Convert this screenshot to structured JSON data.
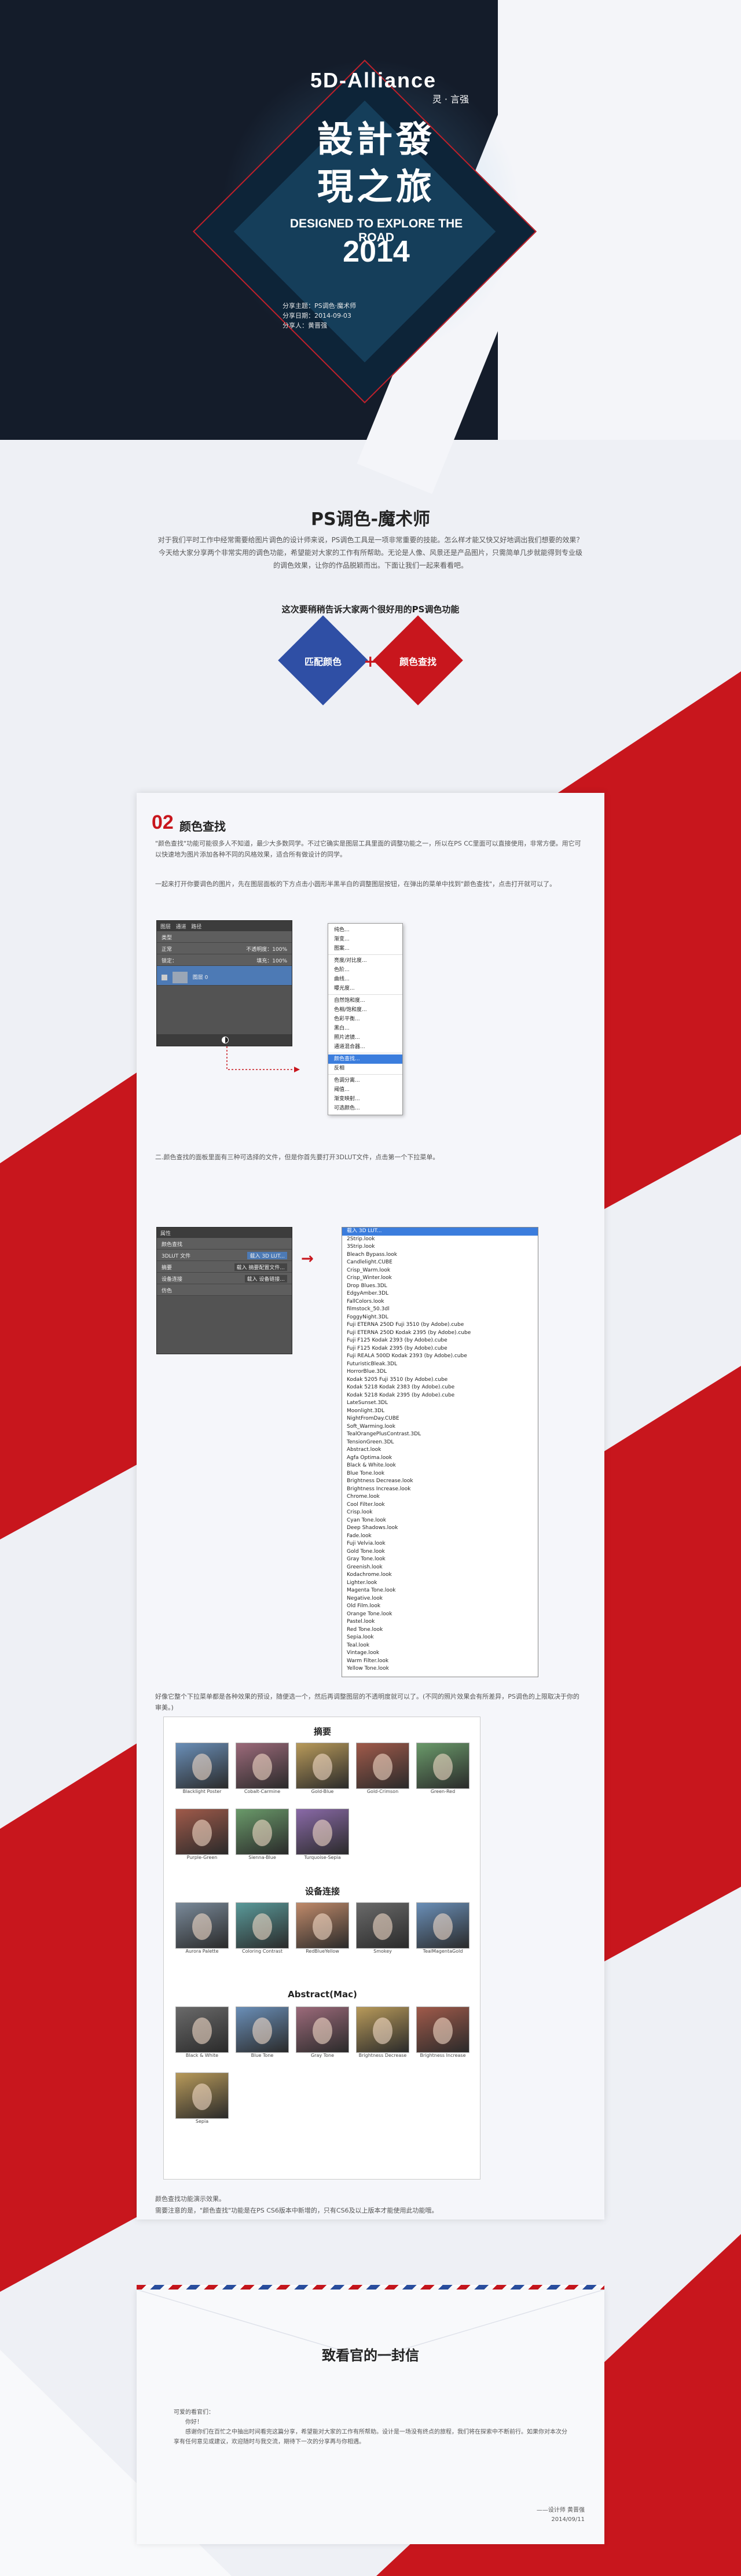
{
  "hero": {
    "brand": "5D-Alliance",
    "org": "灵 · 言强",
    "title_line1": "設計發",
    "title_line2": "現之旅",
    "subtitle_en": "DESIGNED TO EXPLORE THE ROAD",
    "year": "2014",
    "meta": [
      "分享主题：PS调色·魔术师",
      "分享日期：2014-09-03",
      "分享人：黄晋强"
    ]
  },
  "intro": {
    "title": "PS调色-魔术师",
    "text": "对于我们平时工作中经常需要给图片调色的设计师来说，PS调色工具是一项非常重要的技能。怎么样才能又快又好地调出我们想要的效果？今天给大家分享两个非常实用的调色功能，希望能对大家的工作有所帮助。无论是人像、风景还是产品图片，只需简单几步就能得到专业级的调色效果，让你的作品脱颖而出。下面让我们一起来看看吧。",
    "lead": "这次要稍稍告诉大家两个很好用的PS调色功能",
    "btn_match": "匹配颜色",
    "btn_plus": "+",
    "btn_lookup": "颜色查找"
  },
  "section": {
    "number": "02",
    "title": "颜色查找",
    "p1": "\"颜色查找\"功能可能很多人不知道，最少大多数同学。不过它确实是图层工具里面的调整功能之一，所以在PS CC里面可以直接使用，非常方便。用它可以快速地为图片添加各种不同的风格效果，适合所有做设计的同学。",
    "p2": "一起来打开你要调色的图片，先在图层面板的下方点击小圆形半黑半白的调整图层按钮，在弹出的菜单中找到\"颜色查找\"，点击打开就可以了。",
    "p3": "二.颜色查找的面板里面有三种可选择的文件，但是你首先要打开3DLUT文件，点击第一个下拉菜单。",
    "p4": "好像它整个下拉菜单都是各种效果的预设，随便选一个，然后再调整图层的不透明度就可以了。(不同的照片效果会有所差异，PS调色的上限取决于你的审美。)",
    "footer1": "颜色查找功能演示效果。",
    "footer2": "需要注意的是，\"颜色查找\"功能是在PS CS6版本中新增的，只有CS6及以上版本才能使用此功能哦。"
  },
  "ps_panel": {
    "tabs": [
      "图层",
      "通道",
      "路径"
    ],
    "filter": "类型",
    "mode": "正常",
    "opacity_label": "不透明度：",
    "opacity": "100%",
    "fill_label": "填充：",
    "fill": "100%",
    "lock_label": "锁定：",
    "layer": "图层 0"
  },
  "adj_menu": {
    "items": [
      "纯色...",
      "渐变...",
      "图案...",
      "亮度/对比度...",
      "色阶...",
      "曲线...",
      "曝光度...",
      "自然饱和度...",
      "色相/饱和度...",
      "色彩平衡...",
      "黑白...",
      "照片滤镜...",
      "通道混合器...",
      "颜色查找...",
      "反相",
      "色调分离...",
      "阈值...",
      "渐变映射...",
      "可选颜色..."
    ],
    "highlight": "颜色查找..."
  },
  "props_panel": {
    "title": "属性",
    "header": "颜色查找",
    "rows": [
      "3DLUT 文件",
      "摘要",
      "设备连接",
      "仿色"
    ],
    "values": [
      "载入 3D LUT...",
      "载入 摘要配置文件...",
      "载入 设备链接..."
    ]
  },
  "lut_list": {
    "items": [
      "载入 3D LUT...",
      "2Strip.look",
      "3Strip.look",
      "Bleach Bypass.look",
      "Candlelight.CUBE",
      "Crisp_Warm.look",
      "Crisp_Winter.look",
      "Drop Blues.3DL",
      "EdgyAmber.3DL",
      "FallColors.look",
      "filmstock_50.3dl",
      "FoggyNight.3DL",
      "Fuji ETERNA 250D Fuji 3510 (by Adobe).cube",
      "Fuji ETERNA 250D Kodak 2395 (by Adobe).cube",
      "Fuji F125 Kodak 2393 (by Adobe).cube",
      "Fuji F125 Kodak 2395 (by Adobe).cube",
      "Fuji REALA 500D Kodak 2393 (by Adobe).cube",
      "FuturisticBleak.3DL",
      "HorrorBlue.3DL",
      "Kodak 5205 Fuji 3510 (by Adobe).cube",
      "Kodak 5218 Kodak 2383 (by Adobe).cube",
      "Kodak 5218 Kodak 2395 (by Adobe).cube",
      "LateSunset.3DL",
      "Moonlight.3DL",
      "NightFromDay.CUBE",
      "Soft_Warming.look",
      "TealOrangePlusContrast.3DL",
      "TensionGreen.3DL",
      "Abstract.look",
      "Agfa Optima.look",
      "Black & White.look",
      "Blue Tone.look",
      "Brightness Decrease.look",
      "Brightness Increase.look",
      "Chrome.look",
      "Cool Filter.look",
      "Crisp.look",
      "Cyan Tone.look",
      "Deep Shadows.look",
      "Fade.look",
      "Fuji Velvia.look",
      "Gold Tone.look",
      "Gray Tone.look",
      "Greenish.look",
      "Kodachrome.look",
      "Lighter.look",
      "Magenta Tone.look",
      "Negative.look",
      "Old Film.look",
      "Orange Tone.look",
      "Pastel.look",
      "Red Tone.look",
      "Sepia.look",
      "Teal.look",
      "Vintage.look",
      "Warm Filter.look",
      "Yellow Tone.look"
    ],
    "highlight": "载入 3D LUT..."
  },
  "lut_grid": {
    "head1": "摘要",
    "row1": [
      "Blacklight Poster",
      "Cobalt-Carmine",
      "Gold-Blue",
      "Gold-Crimson",
      "Green-Red"
    ],
    "row2": [
      "Purple-Green",
      "Sienna-Blue",
      "Turquoise-Sepia"
    ],
    "head2": "设备连接",
    "row3": [
      "Aurora Palette",
      "Coloring Contrast",
      "RedBlueYellow",
      "Smokey",
      "TealMagentaGold"
    ],
    "head3": "Abstract(Mac)",
    "row4": [
      "Black & White",
      "Blue Tone",
      "Gray Tone",
      "Brightness Decrease",
      "Brightness Increase"
    ],
    "row5": [
      "Sepia"
    ]
  },
  "letter": {
    "title": "致看官的一封信",
    "salutation": "可爱的看官们：",
    "greeting": "你好！",
    "body": "感谢你们在百忙之中抽出时间看完这篇分享，希望能对大家的工作有所帮助。设计是一场没有终点的旅程，我们将在探索中不断前行。如果你对本次分享有任何意见或建议，欢迎随时与我交流，期待下一次的分享再与你相遇。",
    "sign": "——设计师 黄晋强",
    "date": "2014/09/11"
  },
  "colors": {
    "red": "#c8161d",
    "blue": "#2a4fa0",
    "dark": "#141c2a"
  }
}
